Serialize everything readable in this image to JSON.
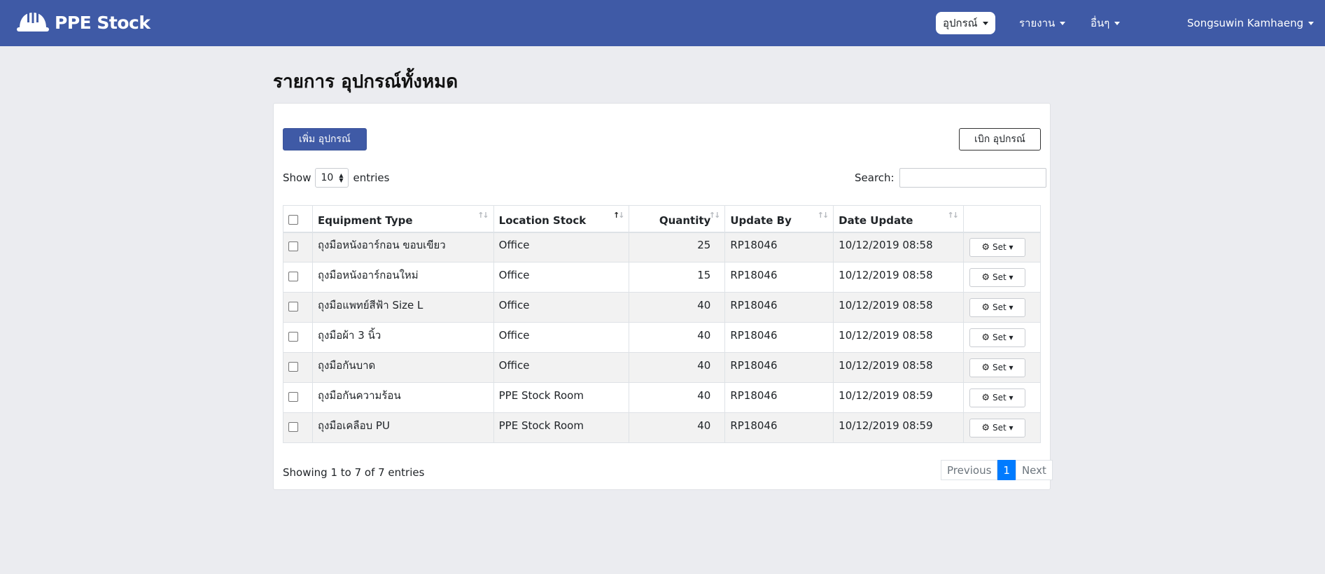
{
  "app": {
    "brand": "PPE Stock"
  },
  "nav": {
    "equipment": "อุปกรณ์",
    "report": "รายงาน",
    "other": "อื่นๆ",
    "user": "Songsuwin Kamhaeng"
  },
  "page": {
    "title": "รายการ อุปกรณ์ทั้งหมด"
  },
  "actions": {
    "add": "เพิ่ม อุปกรณ์",
    "withdraw": "เบิก อุปกรณ์"
  },
  "length": {
    "show": "Show",
    "value": "10",
    "entries": "entries"
  },
  "search": {
    "label": "Search:"
  },
  "table": {
    "headers": [
      "Equipment Type",
      "Location Stock",
      "Quantity",
      "Update By",
      "Date Update"
    ],
    "set_label": "Set ▾",
    "rows": [
      {
        "type": "ถุงมือหนังอาร์กอน ขอบเขียว",
        "location": "Office",
        "qty": "25",
        "by": "RP18046",
        "date": "10/12/2019 08:58"
      },
      {
        "type": "ถุงมือหนังอาร์กอนใหม่",
        "location": "Office",
        "qty": "15",
        "by": "RP18046",
        "date": "10/12/2019 08:58"
      },
      {
        "type": "ถุงมือแพทย์สีฟ้า Size L",
        "location": "Office",
        "qty": "40",
        "by": "RP18046",
        "date": "10/12/2019 08:58"
      },
      {
        "type": "ถุงมือผ้า 3 นิ้ว",
        "location": "Office",
        "qty": "40",
        "by": "RP18046",
        "date": "10/12/2019 08:58"
      },
      {
        "type": "ถุงมือกันบาด",
        "location": "Office",
        "qty": "40",
        "by": "RP18046",
        "date": "10/12/2019 08:58"
      },
      {
        "type": "ถุงมือกันความร้อน",
        "location": "PPE Stock Room",
        "qty": "40",
        "by": "RP18046",
        "date": "10/12/2019 08:59"
      },
      {
        "type": "ถุงมือเคลือบ PU",
        "location": "PPE Stock Room",
        "qty": "40",
        "by": "RP18046",
        "date": "10/12/2019 08:59"
      }
    ]
  },
  "footer": {
    "info": "Showing 1 to 7 of 7 entries",
    "prev": "Previous",
    "page": "1",
    "next": "Next"
  },
  "colors": {
    "navbar": "#3f5aa6",
    "primary_button": "#3f5aa6",
    "pager_active": "#007bff"
  }
}
